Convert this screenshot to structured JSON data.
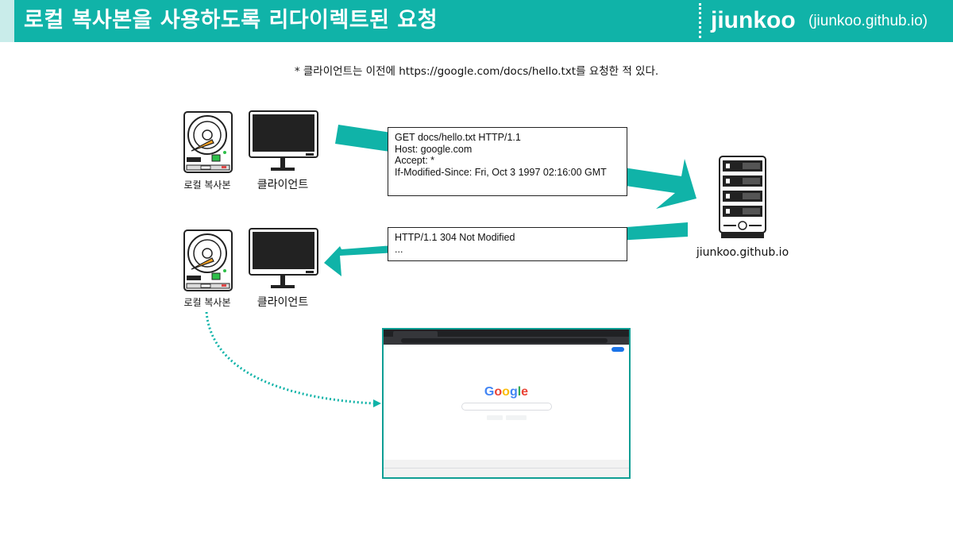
{
  "header": {
    "title": "로컬 복사본을 사용하도록 리다이렉트된 요청",
    "brand_name": "jiunkoo",
    "brand_url": "(jiunkoo.github.io)"
  },
  "note": "* 클라이언트는 이전에 https://google.com/docs/hello.txt를 요청한 적 있다.",
  "labels": {
    "local_copy": "로컬 복사본",
    "client": "클라이언트",
    "server": "jiunkoo.github.io"
  },
  "request": {
    "lines": [
      "GET docs/hello.txt HTTP/1.1",
      "Host: google.com",
      "Accept: *",
      "If-Modified-Since: Fri, Oct 3 1997 02:16:00 GMT"
    ]
  },
  "response": {
    "lines": [
      "HTTP/1.1 304 Not Modified",
      "..."
    ]
  },
  "colors": {
    "teal": "#10b3a8",
    "teal_light": "#c9ecea",
    "disk_green": "#2fbf4a",
    "disk_red": "#e04848",
    "disk_orange": "#f5a020"
  }
}
